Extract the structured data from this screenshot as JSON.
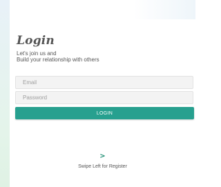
{
  "screen": {
    "title": "Login",
    "subtitle_line1": "Let's join us and",
    "subtitle_line2": "Build your relationship with others"
  },
  "form": {
    "email": {
      "placeholder": "Email",
      "value": ""
    },
    "password": {
      "placeholder": "Password",
      "value": ""
    },
    "login_button": "LOGIN"
  },
  "footer": {
    "chevron_icon": "chevron-right-icon",
    "chevron_glyph": ">",
    "swipe_text": "Swipe Left for Register"
  },
  "colors": {
    "accent": "#27a08f",
    "chevron": "#1f8e73",
    "text": "#555555",
    "field_bg": "#f3f3f3"
  }
}
